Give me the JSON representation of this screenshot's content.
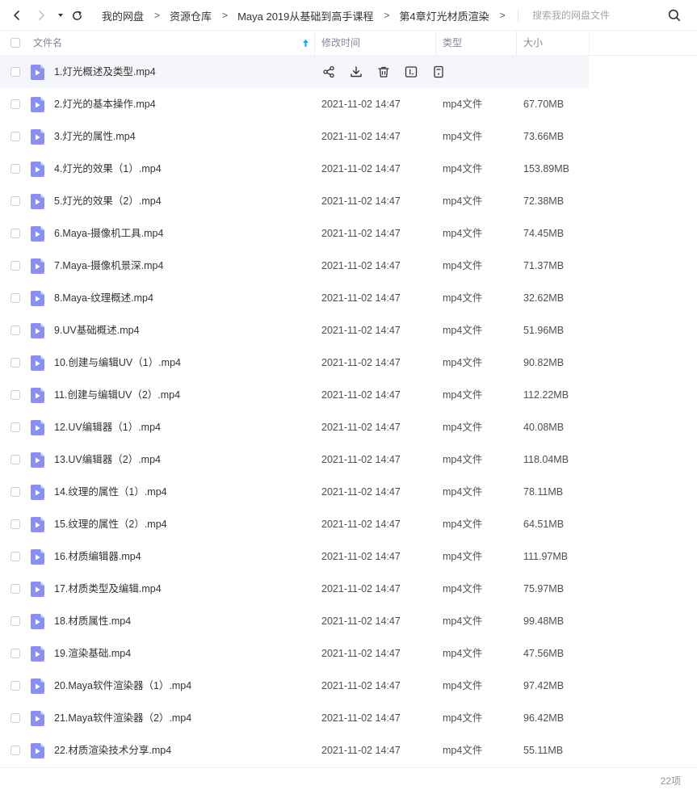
{
  "nav": {
    "breadcrumb": [
      "我的网盘",
      "资源仓库",
      "Maya 2019从基础到高手课程",
      "第4章灯光材质渲染"
    ],
    "breadcrumb_separator": ">",
    "search_placeholder": "搜索我的网盘文件"
  },
  "table": {
    "columns": {
      "name": "文件名",
      "modified": "修改时间",
      "type": "类型",
      "size": "大小"
    },
    "rows": [
      {
        "name": "1.灯光概述及类型.mp4",
        "modified": "",
        "type": "",
        "size": "",
        "hovered": true
      },
      {
        "name": "2.灯光的基本操作.mp4",
        "modified": "2021-11-02 14:47",
        "type": "mp4文件",
        "size": "67.70MB"
      },
      {
        "name": "3.灯光的属性.mp4",
        "modified": "2021-11-02 14:47",
        "type": "mp4文件",
        "size": "73.66MB"
      },
      {
        "name": "4.灯光的效果（1）.mp4",
        "modified": "2021-11-02 14:47",
        "type": "mp4文件",
        "size": "153.89MB"
      },
      {
        "name": "5.灯光的效果（2）.mp4",
        "modified": "2021-11-02 14:47",
        "type": "mp4文件",
        "size": "72.38MB"
      },
      {
        "name": "6.Maya-摄像机工具.mp4",
        "modified": "2021-11-02 14:47",
        "type": "mp4文件",
        "size": "74.45MB"
      },
      {
        "name": "7.Maya-摄像机景深.mp4",
        "modified": "2021-11-02 14:47",
        "type": "mp4文件",
        "size": "71.37MB"
      },
      {
        "name": "8.Maya-纹理概述.mp4",
        "modified": "2021-11-02 14:47",
        "type": "mp4文件",
        "size": "32.62MB"
      },
      {
        "name": "9.UV基础概述.mp4",
        "modified": "2021-11-02 14:47",
        "type": "mp4文件",
        "size": "51.96MB"
      },
      {
        "name": "10.创建与编辑UV（1）.mp4",
        "modified": "2021-11-02 14:47",
        "type": "mp4文件",
        "size": "90.82MB"
      },
      {
        "name": "11.创建与编辑UV（2）.mp4",
        "modified": "2021-11-02 14:47",
        "type": "mp4文件",
        "size": "112.22MB"
      },
      {
        "name": "12.UV编辑器（1）.mp4",
        "modified": "2021-11-02 14:47",
        "type": "mp4文件",
        "size": "40.08MB"
      },
      {
        "name": "13.UV编辑器（2）.mp4",
        "modified": "2021-11-02 14:47",
        "type": "mp4文件",
        "size": "118.04MB"
      },
      {
        "name": "14.纹理的属性（1）.mp4",
        "modified": "2021-11-02 14:47",
        "type": "mp4文件",
        "size": "78.11MB"
      },
      {
        "name": "15.纹理的属性（2）.mp4",
        "modified": "2021-11-02 14:47",
        "type": "mp4文件",
        "size": "64.51MB"
      },
      {
        "name": "16.材质编辑器.mp4",
        "modified": "2021-11-02 14:47",
        "type": "mp4文件",
        "size": "111.97MB"
      },
      {
        "name": "17.材质类型及编辑.mp4",
        "modified": "2021-11-02 14:47",
        "type": "mp4文件",
        "size": "75.97MB"
      },
      {
        "name": "18.材质属性.mp4",
        "modified": "2021-11-02 14:47",
        "type": "mp4文件",
        "size": "99.48MB"
      },
      {
        "name": "19.渲染基础.mp4",
        "modified": "2021-11-02 14:47",
        "type": "mp4文件",
        "size": "47.56MB"
      },
      {
        "name": "20.Maya软件渲染器（1）.mp4",
        "modified": "2021-11-02 14:47",
        "type": "mp4文件",
        "size": "97.42MB"
      },
      {
        "name": "21.Maya软件渲染器（2）.mp4",
        "modified": "2021-11-02 14:47",
        "type": "mp4文件",
        "size": "96.42MB"
      },
      {
        "name": "22.材质渲染技术分享.mp4",
        "modified": "2021-11-02 14:47",
        "type": "mp4文件",
        "size": "55.11MB"
      }
    ],
    "row_actions": [
      "share-icon",
      "download-icon",
      "delete-icon",
      "rename-icon",
      "more-icon"
    ]
  },
  "footer": {
    "count": "22项"
  },
  "colors": {
    "accent": "#06a7ff",
    "file_icon": "#8a8ff2",
    "hover_row": "#f5f6f9",
    "header_text": "#818999"
  }
}
